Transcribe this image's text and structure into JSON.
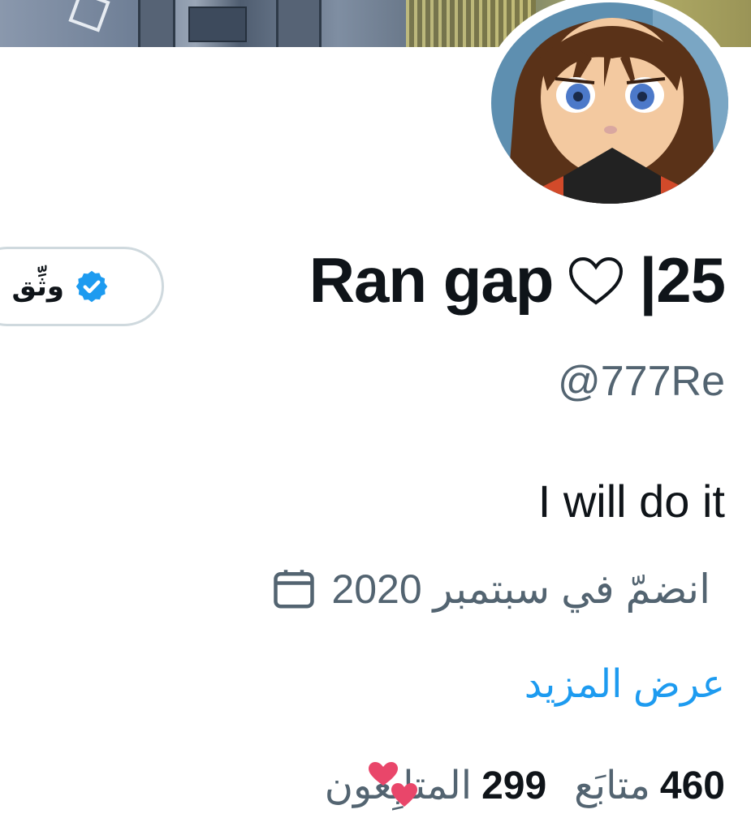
{
  "profile": {
    "display_name": "Ran gap",
    "name_suffix": "|25",
    "handle": "@777Re",
    "bio": "I will do it",
    "joined_text": "انضمّ في سبتمبر 2020",
    "show_more": "عرض المزيد",
    "follow_button_label": "وثِّق"
  },
  "stats": {
    "following_count": "460",
    "following_label": "متابَع",
    "followers_count": "299",
    "followers_label": "المتابِعون"
  },
  "icons": {
    "verified": "verified-badge-icon",
    "calendar": "calendar-icon",
    "name_heart": "heart-outline-icon",
    "stat_hearts": "red-hearts-icon"
  },
  "colors": {
    "accent": "#1d9bf0",
    "secondary_text": "#536471",
    "primary_text": "#0f1419",
    "hearts": "#e9466a"
  }
}
